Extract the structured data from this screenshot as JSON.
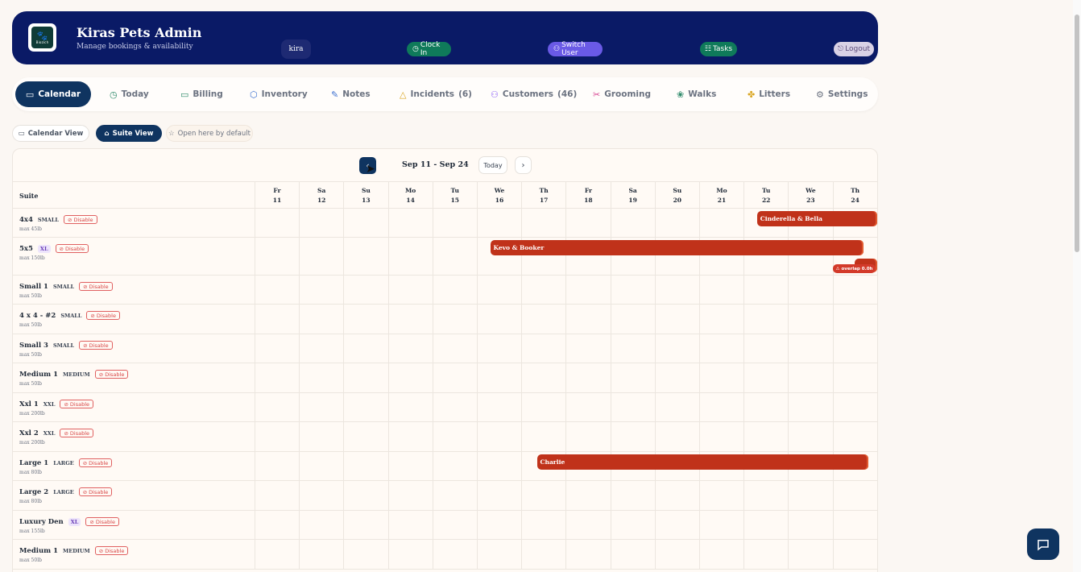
{
  "header": {
    "title": "Kiras Pets Admin",
    "subtitle": "Manage bookings & availability",
    "logo_text": "Biozich",
    "user": "kira",
    "clock_in": "Clock In",
    "switch_user": "Switch User",
    "tasks": "Tasks",
    "logout": "Logout"
  },
  "nav": [
    {
      "label": "Calendar",
      "icon": "calendar-icon"
    },
    {
      "label": "Today",
      "icon": "clock-icon"
    },
    {
      "label": "Billing",
      "icon": "card-icon"
    },
    {
      "label": "Inventory",
      "icon": "box-icon"
    },
    {
      "label": "Notes",
      "icon": "edit-icon"
    },
    {
      "label": "Incidents",
      "icon": "warning-icon",
      "count": "(6)"
    },
    {
      "label": "Customers",
      "icon": "users-icon",
      "count": "(46)"
    },
    {
      "label": "Grooming",
      "icon": "scissors-icon"
    },
    {
      "label": "Walks",
      "icon": "paw-icon"
    },
    {
      "label": "Litters",
      "icon": "puzzle-icon"
    },
    {
      "label": "Settings",
      "icon": "gear-icon"
    }
  ],
  "views": {
    "calendar_view": "Calendar View",
    "suite_view": "Suite View",
    "open_default": "Open here by default"
  },
  "toolbar": {
    "range": "Sep 11 - Sep 24",
    "today": "Today"
  },
  "grid": {
    "suite_header": "Suite",
    "days": [
      {
        "dow": "Fr",
        "day": "11"
      },
      {
        "dow": "Sa",
        "day": "12"
      },
      {
        "dow": "Su",
        "day": "13"
      },
      {
        "dow": "Mo",
        "day": "14"
      },
      {
        "dow": "Tu",
        "day": "15"
      },
      {
        "dow": "We",
        "day": "16"
      },
      {
        "dow": "Th",
        "day": "17"
      },
      {
        "dow": "Fr",
        "day": "18"
      },
      {
        "dow": "Sa",
        "day": "19"
      },
      {
        "dow": "Su",
        "day": "20"
      },
      {
        "dow": "Mo",
        "day": "21"
      },
      {
        "dow": "Tu",
        "day": "22"
      },
      {
        "dow": "We",
        "day": "23"
      },
      {
        "dow": "Th",
        "day": "24"
      }
    ],
    "disable_label": "Disable",
    "suites": [
      {
        "name": "4x4",
        "size": "SMALL",
        "xl": false,
        "max": "max 45lb"
      },
      {
        "name": "5x5",
        "size": "XL",
        "xl": true,
        "max": "max 150lb"
      },
      {
        "name": "Small 1",
        "size": "SMALL",
        "xl": false,
        "max": "max 50lb"
      },
      {
        "name": "4 x 4 - #2",
        "size": "SMALL",
        "xl": false,
        "max": "max 50lb"
      },
      {
        "name": "Small 3",
        "size": "SMALL",
        "xl": false,
        "max": "max 50lb"
      },
      {
        "name": "Medium 1",
        "size": "MEDIUM",
        "xl": false,
        "max": "max 50lb"
      },
      {
        "name": "Xxl 1",
        "size": "XXL",
        "xl": false,
        "max": "max 200lb"
      },
      {
        "name": "Xxl 2",
        "size": "XXL",
        "xl": false,
        "max": "max 200lb"
      },
      {
        "name": "Large 1",
        "size": "LARGE",
        "xl": false,
        "max": "max 80lb"
      },
      {
        "name": "Large 2",
        "size": "LARGE",
        "xl": false,
        "max": "max 80lb"
      },
      {
        "name": "Luxury Den",
        "size": "XL",
        "xl": true,
        "max": "max 155lb"
      },
      {
        "name": "Medium 1",
        "size": "MEDIUM",
        "xl": false,
        "max": "max 50lb"
      }
    ],
    "bookings": [
      {
        "suite": 0,
        "start": 11.3,
        "end": 14,
        "label": "Cinderella & Bella"
      },
      {
        "suite": 1,
        "start": 5.3,
        "end": 13.7,
        "label": "Kevo & Booker"
      },
      {
        "suite": 8,
        "start": 6.35,
        "end": 13.8,
        "label": "Charlie"
      }
    ],
    "overlap": {
      "suite": 1,
      "label": "overlap 0.0h"
    }
  },
  "colors": {
    "primary": "#0f3460",
    "header": "#0a1a66",
    "booking": "#c0321a"
  }
}
